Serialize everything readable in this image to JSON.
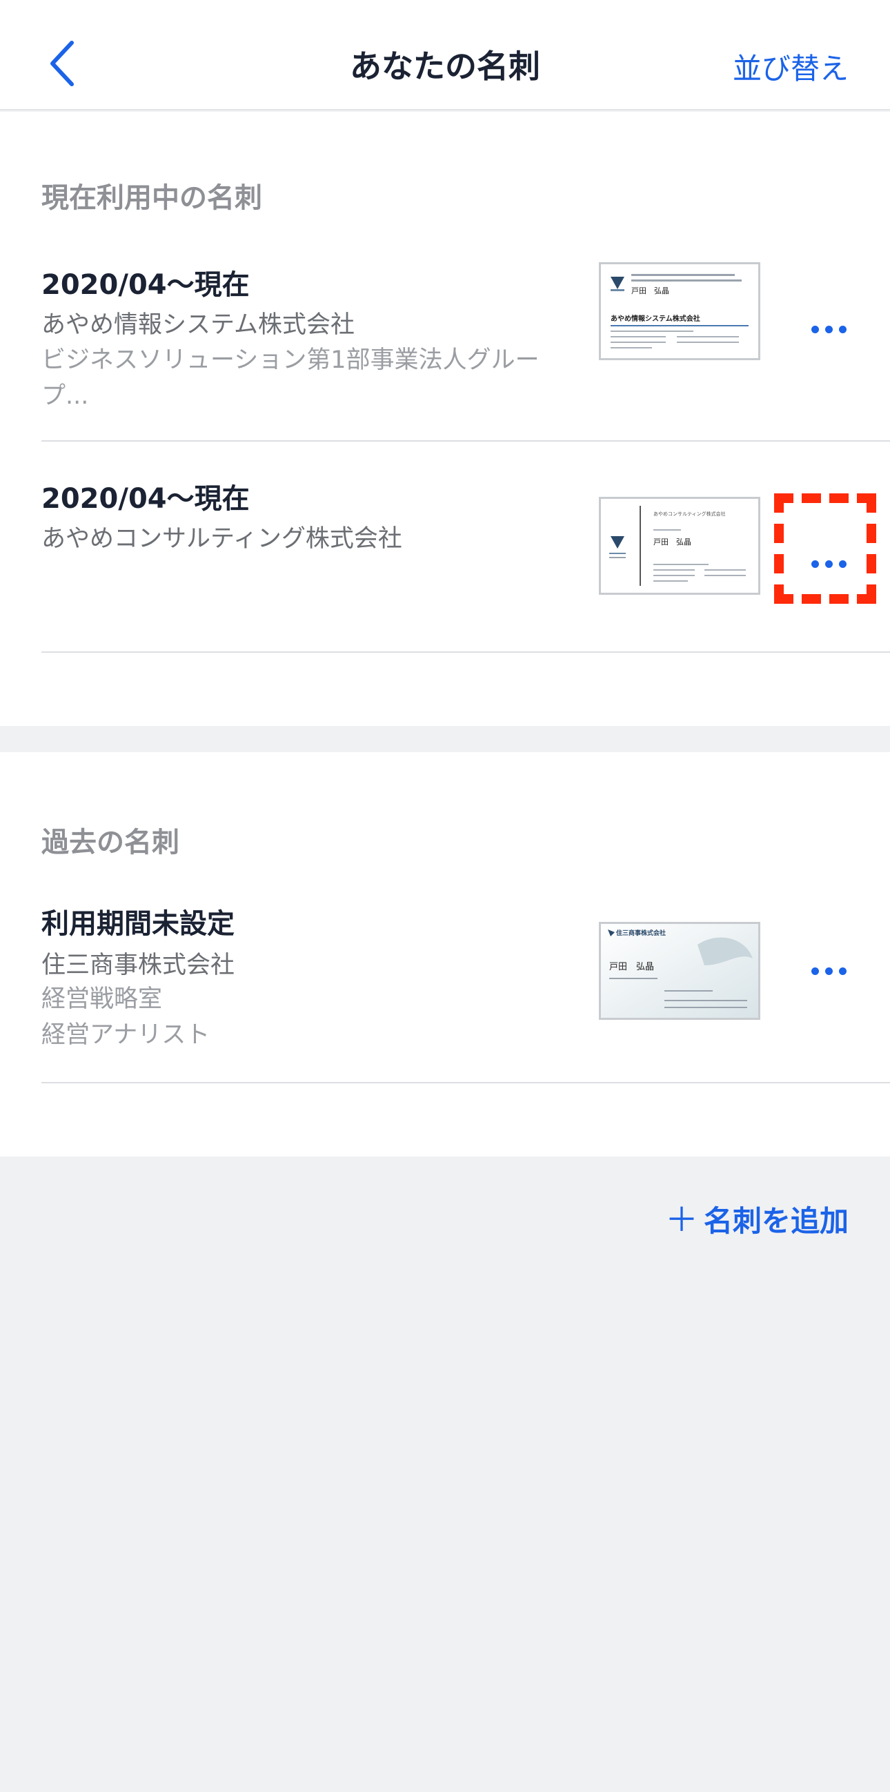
{
  "header": {
    "title": "あなたの名刺",
    "sort_label": "並び替え"
  },
  "current": {
    "section_title": "現在利用中の名刺",
    "cards": [
      {
        "period": "2020/04〜現在",
        "company": "あやめ情報システム株式会社",
        "department": "ビジネスソリューション第1部事業法人グルー",
        "department_cont": "プ..."
      },
      {
        "period": "2020/04〜現在",
        "company": "あやめコンサルティング株式会社"
      }
    ]
  },
  "past": {
    "section_title": "過去の名刺",
    "cards": [
      {
        "period": "利用期間未設定",
        "company": "住三商事株式会社",
        "department": "経営戦略室",
        "position": "経営アナリスト"
      }
    ]
  },
  "thumbnails": {
    "card1_company": "あやめ情報システム株式会社",
    "card1_name": "戸田　弘晶",
    "card2_company": "あやめコンサルティング株式会社",
    "card2_name": "戸田　弘晶",
    "card3_company": "住三商事株式会社",
    "card3_name": "戸田　弘晶"
  },
  "footer": {
    "add_label": "名刺を追加"
  },
  "colors": {
    "accent": "#1b63e8",
    "highlight": "#ff2a0a",
    "background": "#f0f1f3"
  }
}
